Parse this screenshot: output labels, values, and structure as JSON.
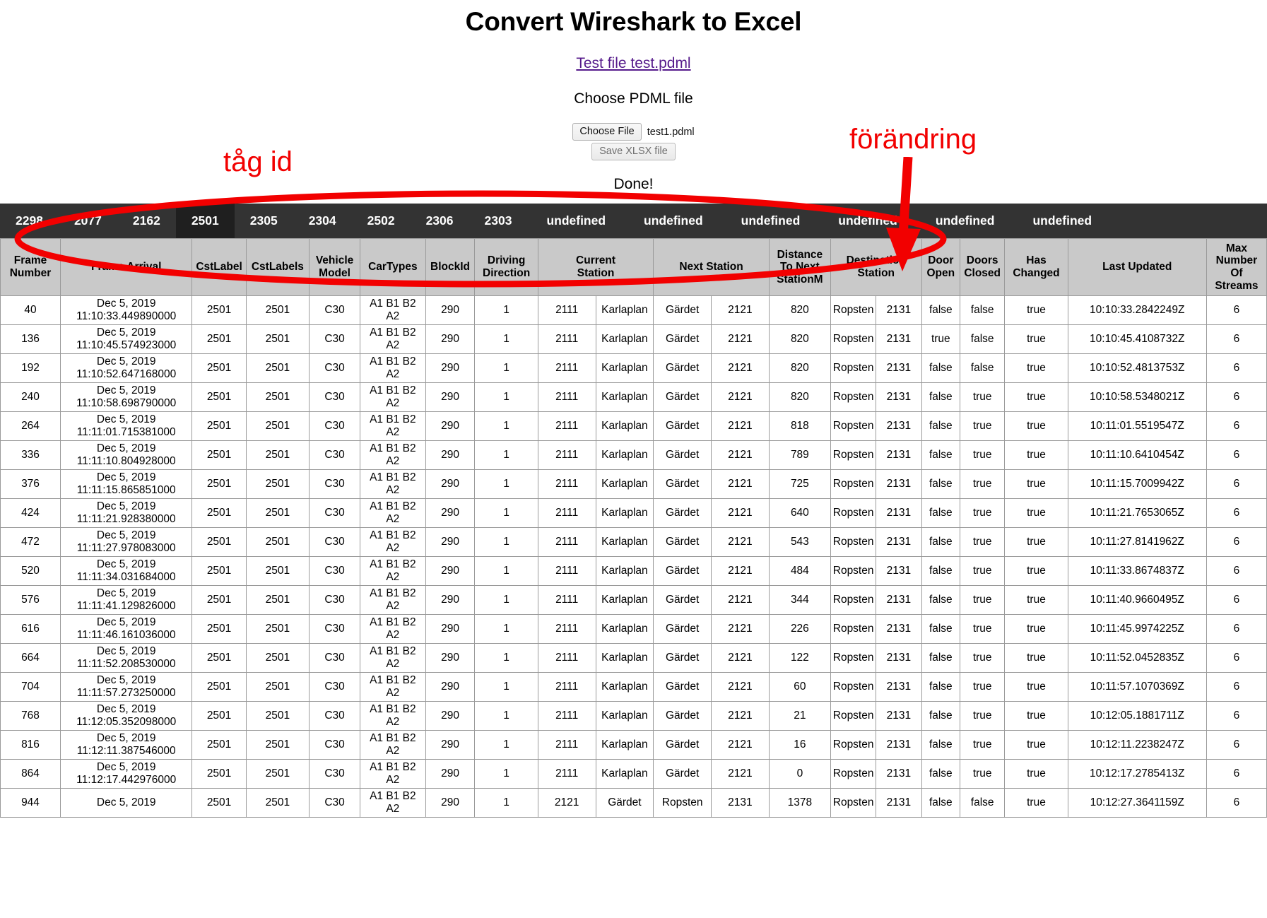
{
  "header": {
    "title": "Convert Wireshark to Excel",
    "test_file_link": "Test file test.pdml",
    "choose_label": "Choose PDML file",
    "choose_file_button": "Choose File",
    "chosen_file_name": "test1.pdml",
    "save_button": "Save XLSX file",
    "status": "Done!"
  },
  "annotations": {
    "tag_id": "tåg id",
    "forandring": "förändring",
    "color": "#f20000"
  },
  "tabs": {
    "active_index": 3,
    "items": [
      "2298",
      "2077",
      "2162",
      "2501",
      "2305",
      "2304",
      "2502",
      "2306",
      "2303",
      "undefined",
      "undefined",
      "undefined",
      "undefined",
      "undefined",
      "undefined"
    ]
  },
  "table": {
    "columns": [
      "Frame Number",
      "Frame Arrival",
      "CstLabel",
      "CstLabels",
      "Vehicle Model",
      "CarTypes",
      "BlockId",
      "Driving Direction",
      "Current Station",
      "Next Station",
      "Distance To Next StationM",
      "Destination Station",
      "Door Open",
      "Doors Closed",
      "Has Changed",
      "Last Updated",
      "Max Number Of Streams"
    ],
    "column_lines": [
      [
        "Frame",
        "Number"
      ],
      [
        "Frame Arrival"
      ],
      [
        "CstLabel"
      ],
      [
        "CstLabels"
      ],
      [
        "Vehicle",
        "Model"
      ],
      [
        "CarTypes"
      ],
      [
        "BlockId"
      ],
      [
        "Driving",
        "Direction"
      ],
      [
        "Current",
        "Station"
      ],
      [
        "Next Station"
      ],
      [
        "Distance",
        "To Next",
        "StationM"
      ],
      [
        "Destination",
        "Station"
      ],
      [
        "Door",
        "Open"
      ],
      [
        "Doors",
        "Closed"
      ],
      [
        "Has",
        "Changed"
      ],
      [
        "Last Updated"
      ],
      [
        "Max",
        "Number",
        "Of",
        "Streams"
      ]
    ],
    "rows": [
      {
        "frame_number": "40",
        "arrival_date": "Dec 5, 2019",
        "arrival_time": "11:10:33.449890000",
        "cst_label": "2501",
        "cst_labels": "2501",
        "vehicle_model": "C30",
        "car_types": "A1 B1 B2 A2",
        "block_id": "290",
        "driving_direction": "1",
        "current_station_id": "2111",
        "current_station": "Karlaplan",
        "next_station": "Gärdet",
        "next_station_id": "2121",
        "distance_to_next": "820",
        "destination_station": "Ropsten",
        "destination_station_id": "2131",
        "door_open": "false",
        "doors_closed": "false",
        "has_changed": "true",
        "last_updated": "10:10:33.2842249Z",
        "max_streams": "6"
      },
      {
        "frame_number": "136",
        "arrival_date": "Dec 5, 2019",
        "arrival_time": "11:10:45.574923000",
        "cst_label": "2501",
        "cst_labels": "2501",
        "vehicle_model": "C30",
        "car_types": "A1 B1 B2 A2",
        "block_id": "290",
        "driving_direction": "1",
        "current_station_id": "2111",
        "current_station": "Karlaplan",
        "next_station": "Gärdet",
        "next_station_id": "2121",
        "distance_to_next": "820",
        "destination_station": "Ropsten",
        "destination_station_id": "2131",
        "door_open": "true",
        "doors_closed": "false",
        "has_changed": "true",
        "last_updated": "10:10:45.4108732Z",
        "max_streams": "6"
      },
      {
        "frame_number": "192",
        "arrival_date": "Dec 5, 2019",
        "arrival_time": "11:10:52.647168000",
        "cst_label": "2501",
        "cst_labels": "2501",
        "vehicle_model": "C30",
        "car_types": "A1 B1 B2 A2",
        "block_id": "290",
        "driving_direction": "1",
        "current_station_id": "2111",
        "current_station": "Karlaplan",
        "next_station": "Gärdet",
        "next_station_id": "2121",
        "distance_to_next": "820",
        "destination_station": "Ropsten",
        "destination_station_id": "2131",
        "door_open": "false",
        "doors_closed": "false",
        "has_changed": "true",
        "last_updated": "10:10:52.4813753Z",
        "max_streams": "6"
      },
      {
        "frame_number": "240",
        "arrival_date": "Dec 5, 2019",
        "arrival_time": "11:10:58.698790000",
        "cst_label": "2501",
        "cst_labels": "2501",
        "vehicle_model": "C30",
        "car_types": "A1 B1 B2 A2",
        "block_id": "290",
        "driving_direction": "1",
        "current_station_id": "2111",
        "current_station": "Karlaplan",
        "next_station": "Gärdet",
        "next_station_id": "2121",
        "distance_to_next": "820",
        "destination_station": "Ropsten",
        "destination_station_id": "2131",
        "door_open": "false",
        "doors_closed": "true",
        "has_changed": "true",
        "last_updated": "10:10:58.5348021Z",
        "max_streams": "6"
      },
      {
        "frame_number": "264",
        "arrival_date": "Dec 5, 2019",
        "arrival_time": "11:11:01.715381000",
        "cst_label": "2501",
        "cst_labels": "2501",
        "vehicle_model": "C30",
        "car_types": "A1 B1 B2 A2",
        "block_id": "290",
        "driving_direction": "1",
        "current_station_id": "2111",
        "current_station": "Karlaplan",
        "next_station": "Gärdet",
        "next_station_id": "2121",
        "distance_to_next": "818",
        "destination_station": "Ropsten",
        "destination_station_id": "2131",
        "door_open": "false",
        "doors_closed": "true",
        "has_changed": "true",
        "last_updated": "10:11:01.5519547Z",
        "max_streams": "6"
      },
      {
        "frame_number": "336",
        "arrival_date": "Dec 5, 2019",
        "arrival_time": "11:11:10.804928000",
        "cst_label": "2501",
        "cst_labels": "2501",
        "vehicle_model": "C30",
        "car_types": "A1 B1 B2 A2",
        "block_id": "290",
        "driving_direction": "1",
        "current_station_id": "2111",
        "current_station": "Karlaplan",
        "next_station": "Gärdet",
        "next_station_id": "2121",
        "distance_to_next": "789",
        "destination_station": "Ropsten",
        "destination_station_id": "2131",
        "door_open": "false",
        "doors_closed": "true",
        "has_changed": "true",
        "last_updated": "10:11:10.6410454Z",
        "max_streams": "6"
      },
      {
        "frame_number": "376",
        "arrival_date": "Dec 5, 2019",
        "arrival_time": "11:11:15.865851000",
        "cst_label": "2501",
        "cst_labels": "2501",
        "vehicle_model": "C30",
        "car_types": "A1 B1 B2 A2",
        "block_id": "290",
        "driving_direction": "1",
        "current_station_id": "2111",
        "current_station": "Karlaplan",
        "next_station": "Gärdet",
        "next_station_id": "2121",
        "distance_to_next": "725",
        "destination_station": "Ropsten",
        "destination_station_id": "2131",
        "door_open": "false",
        "doors_closed": "true",
        "has_changed": "true",
        "last_updated": "10:11:15.7009942Z",
        "max_streams": "6"
      },
      {
        "frame_number": "424",
        "arrival_date": "Dec 5, 2019",
        "arrival_time": "11:11:21.928380000",
        "cst_label": "2501",
        "cst_labels": "2501",
        "vehicle_model": "C30",
        "car_types": "A1 B1 B2 A2",
        "block_id": "290",
        "driving_direction": "1",
        "current_station_id": "2111",
        "current_station": "Karlaplan",
        "next_station": "Gärdet",
        "next_station_id": "2121",
        "distance_to_next": "640",
        "destination_station": "Ropsten",
        "destination_station_id": "2131",
        "door_open": "false",
        "doors_closed": "true",
        "has_changed": "true",
        "last_updated": "10:11:21.7653065Z",
        "max_streams": "6"
      },
      {
        "frame_number": "472",
        "arrival_date": "Dec 5, 2019",
        "arrival_time": "11:11:27.978083000",
        "cst_label": "2501",
        "cst_labels": "2501",
        "vehicle_model": "C30",
        "car_types": "A1 B1 B2 A2",
        "block_id": "290",
        "driving_direction": "1",
        "current_station_id": "2111",
        "current_station": "Karlaplan",
        "next_station": "Gärdet",
        "next_station_id": "2121",
        "distance_to_next": "543",
        "destination_station": "Ropsten",
        "destination_station_id": "2131",
        "door_open": "false",
        "doors_closed": "true",
        "has_changed": "true",
        "last_updated": "10:11:27.8141962Z",
        "max_streams": "6"
      },
      {
        "frame_number": "520",
        "arrival_date": "Dec 5, 2019",
        "arrival_time": "11:11:34.031684000",
        "cst_label": "2501",
        "cst_labels": "2501",
        "vehicle_model": "C30",
        "car_types": "A1 B1 B2 A2",
        "block_id": "290",
        "driving_direction": "1",
        "current_station_id": "2111",
        "current_station": "Karlaplan",
        "next_station": "Gärdet",
        "next_station_id": "2121",
        "distance_to_next": "484",
        "destination_station": "Ropsten",
        "destination_station_id": "2131",
        "door_open": "false",
        "doors_closed": "true",
        "has_changed": "true",
        "last_updated": "10:11:33.8674837Z",
        "max_streams": "6"
      },
      {
        "frame_number": "576",
        "arrival_date": "Dec 5, 2019",
        "arrival_time": "11:11:41.129826000",
        "cst_label": "2501",
        "cst_labels": "2501",
        "vehicle_model": "C30",
        "car_types": "A1 B1 B2 A2",
        "block_id": "290",
        "driving_direction": "1",
        "current_station_id": "2111",
        "current_station": "Karlaplan",
        "next_station": "Gärdet",
        "next_station_id": "2121",
        "distance_to_next": "344",
        "destination_station": "Ropsten",
        "destination_station_id": "2131",
        "door_open": "false",
        "doors_closed": "true",
        "has_changed": "true",
        "last_updated": "10:11:40.9660495Z",
        "max_streams": "6"
      },
      {
        "frame_number": "616",
        "arrival_date": "Dec 5, 2019",
        "arrival_time": "11:11:46.161036000",
        "cst_label": "2501",
        "cst_labels": "2501",
        "vehicle_model": "C30",
        "car_types": "A1 B1 B2 A2",
        "block_id": "290",
        "driving_direction": "1",
        "current_station_id": "2111",
        "current_station": "Karlaplan",
        "next_station": "Gärdet",
        "next_station_id": "2121",
        "distance_to_next": "226",
        "destination_station": "Ropsten",
        "destination_station_id": "2131",
        "door_open": "false",
        "doors_closed": "true",
        "has_changed": "true",
        "last_updated": "10:11:45.9974225Z",
        "max_streams": "6"
      },
      {
        "frame_number": "664",
        "arrival_date": "Dec 5, 2019",
        "arrival_time": "11:11:52.208530000",
        "cst_label": "2501",
        "cst_labels": "2501",
        "vehicle_model": "C30",
        "car_types": "A1 B1 B2 A2",
        "block_id": "290",
        "driving_direction": "1",
        "current_station_id": "2111",
        "current_station": "Karlaplan",
        "next_station": "Gärdet",
        "next_station_id": "2121",
        "distance_to_next": "122",
        "destination_station": "Ropsten",
        "destination_station_id": "2131",
        "door_open": "false",
        "doors_closed": "true",
        "has_changed": "true",
        "last_updated": "10:11:52.0452835Z",
        "max_streams": "6"
      },
      {
        "frame_number": "704",
        "arrival_date": "Dec 5, 2019",
        "arrival_time": "11:11:57.273250000",
        "cst_label": "2501",
        "cst_labels": "2501",
        "vehicle_model": "C30",
        "car_types": "A1 B1 B2 A2",
        "block_id": "290",
        "driving_direction": "1",
        "current_station_id": "2111",
        "current_station": "Karlaplan",
        "next_station": "Gärdet",
        "next_station_id": "2121",
        "distance_to_next": "60",
        "destination_station": "Ropsten",
        "destination_station_id": "2131",
        "door_open": "false",
        "doors_closed": "true",
        "has_changed": "true",
        "last_updated": "10:11:57.1070369Z",
        "max_streams": "6"
      },
      {
        "frame_number": "768",
        "arrival_date": "Dec 5, 2019",
        "arrival_time": "11:12:05.352098000",
        "cst_label": "2501",
        "cst_labels": "2501",
        "vehicle_model": "C30",
        "car_types": "A1 B1 B2 A2",
        "block_id": "290",
        "driving_direction": "1",
        "current_station_id": "2111",
        "current_station": "Karlaplan",
        "next_station": "Gärdet",
        "next_station_id": "2121",
        "distance_to_next": "21",
        "destination_station": "Ropsten",
        "destination_station_id": "2131",
        "door_open": "false",
        "doors_closed": "true",
        "has_changed": "true",
        "last_updated": "10:12:05.1881711Z",
        "max_streams": "6"
      },
      {
        "frame_number": "816",
        "arrival_date": "Dec 5, 2019",
        "arrival_time": "11:12:11.387546000",
        "cst_label": "2501",
        "cst_labels": "2501",
        "vehicle_model": "C30",
        "car_types": "A1 B1 B2 A2",
        "block_id": "290",
        "driving_direction": "1",
        "current_station_id": "2111",
        "current_station": "Karlaplan",
        "next_station": "Gärdet",
        "next_station_id": "2121",
        "distance_to_next": "16",
        "destination_station": "Ropsten",
        "destination_station_id": "2131",
        "door_open": "false",
        "doors_closed": "true",
        "has_changed": "true",
        "last_updated": "10:12:11.2238247Z",
        "max_streams": "6"
      },
      {
        "frame_number": "864",
        "arrival_date": "Dec 5, 2019",
        "arrival_time": "11:12:17.442976000",
        "cst_label": "2501",
        "cst_labels": "2501",
        "vehicle_model": "C30",
        "car_types": "A1 B1 B2 A2",
        "block_id": "290",
        "driving_direction": "1",
        "current_station_id": "2111",
        "current_station": "Karlaplan",
        "next_station": "Gärdet",
        "next_station_id": "2121",
        "distance_to_next": "0",
        "destination_station": "Ropsten",
        "destination_station_id": "2131",
        "door_open": "false",
        "doors_closed": "true",
        "has_changed": "true",
        "last_updated": "10:12:17.2785413Z",
        "max_streams": "6"
      },
      {
        "frame_number": "944",
        "arrival_date": "Dec 5, 2019",
        "arrival_time": "",
        "cst_label": "2501",
        "cst_labels": "2501",
        "vehicle_model": "C30",
        "car_types": "A1 B1 B2 A2",
        "block_id": "290",
        "driving_direction": "1",
        "current_station_id": "2121",
        "current_station": "Gärdet",
        "next_station": "Ropsten",
        "next_station_id": "2131",
        "distance_to_next": "1378",
        "destination_station": "Ropsten",
        "destination_station_id": "2131",
        "door_open": "false",
        "doors_closed": "false",
        "has_changed": "true",
        "last_updated": "10:12:27.3641159Z",
        "max_streams": "6"
      }
    ]
  }
}
